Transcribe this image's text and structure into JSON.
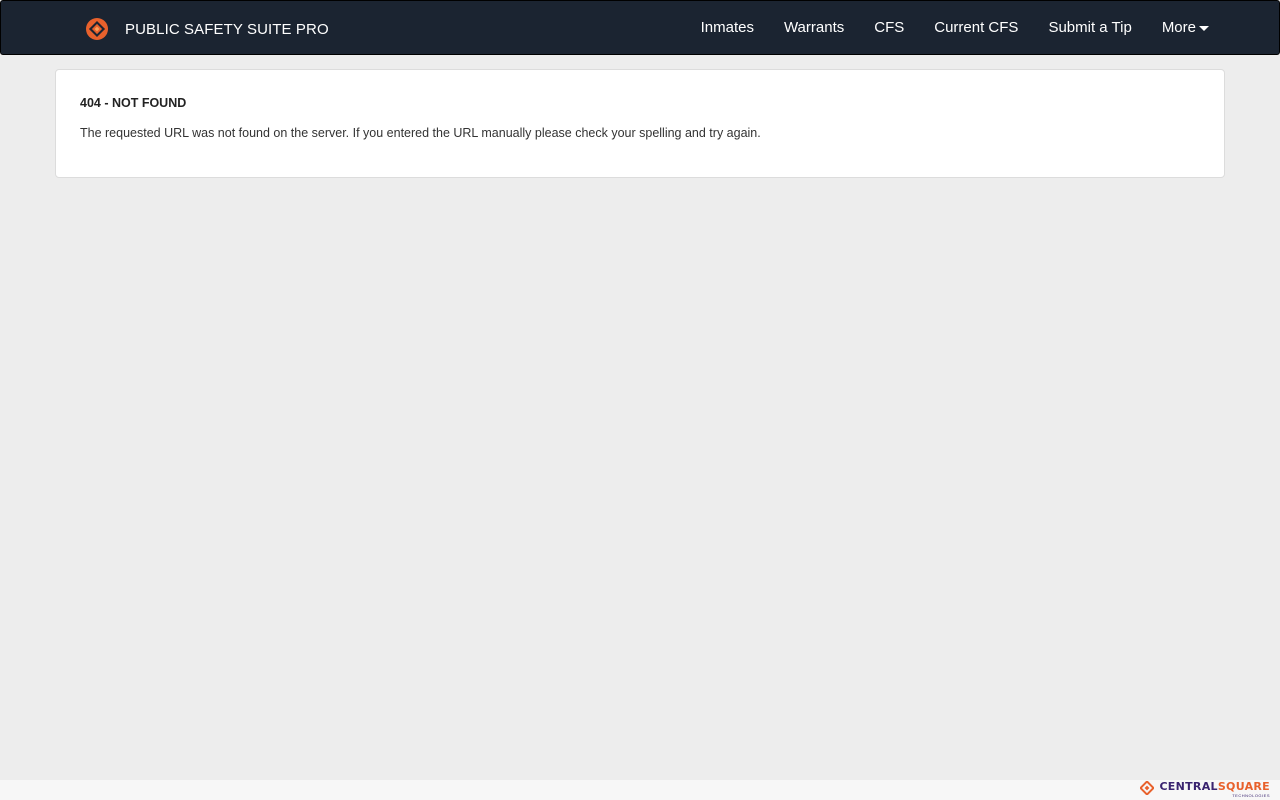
{
  "app": {
    "title": "PUBLIC SAFETY SUITE PRO",
    "logo_icon": "public-safety-logo-icon"
  },
  "nav": {
    "items": [
      {
        "label": "Inmates"
      },
      {
        "label": "Warrants"
      },
      {
        "label": "CFS"
      },
      {
        "label": "Current CFS"
      },
      {
        "label": "Submit a Tip"
      }
    ],
    "more_label": "More",
    "more_icon": "caret-down-icon"
  },
  "error": {
    "title": "404 - NOT FOUND",
    "message": "The requested URL was not found on the server. If you entered the URL manually please check your spelling and try again."
  },
  "footer": {
    "logo_central": "CENTRAL",
    "logo_square": "SQUARE",
    "logo_sub": "TECHNOLOGIES"
  },
  "colors": {
    "navbar": "#1b2431",
    "accent": "#e8612c",
    "background": "#ededed",
    "brand_purple": "#3a2470"
  }
}
